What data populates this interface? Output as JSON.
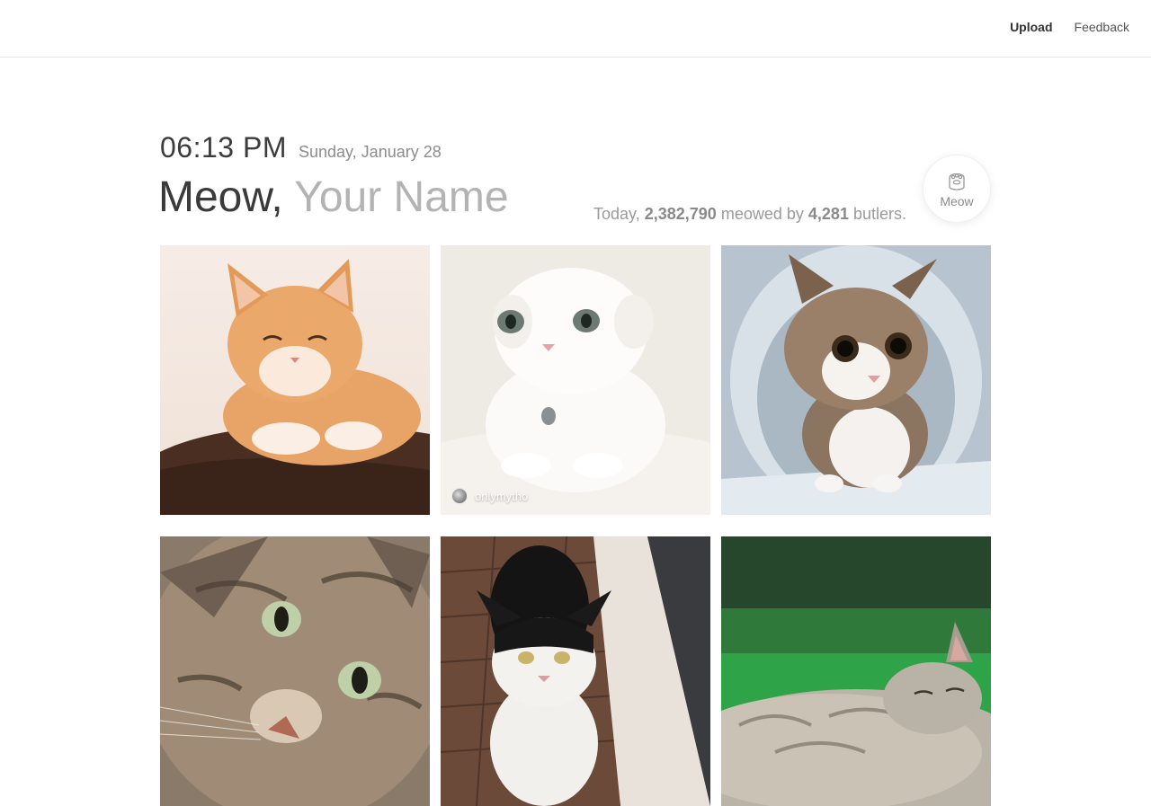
{
  "nav": {
    "upload_label": "Upload",
    "feedback_label": "Feedback"
  },
  "clock": {
    "time": "06:13 PM",
    "date": "Sunday, January 28"
  },
  "greeting": {
    "prefix": "Meow,",
    "name_placeholder": "Your Name"
  },
  "stats": {
    "prefix": "Today,",
    "meows": "2,382,790",
    "middle": "meowed by",
    "butlers": "4,281",
    "suffix": "butlers."
  },
  "meow_button": {
    "label": "Meow",
    "icon": "paw-icon"
  },
  "photos": [
    {
      "subject": "orange-tabby-cat",
      "credit": ""
    },
    {
      "subject": "white-kitten",
      "credit": "onlymytho"
    },
    {
      "subject": "tabby-white-cat-in-tunnel",
      "credit": ""
    },
    {
      "subject": "tabby-cat-closeup",
      "credit": ""
    },
    {
      "subject": "black-white-cat",
      "credit": ""
    },
    {
      "subject": "gray-tabby-sleeping-on-grass",
      "credit": ""
    }
  ],
  "colors": {
    "accent_text": "#3a3a3a",
    "muted_text": "#b3b3b3",
    "divider": "#e6e6e6"
  }
}
